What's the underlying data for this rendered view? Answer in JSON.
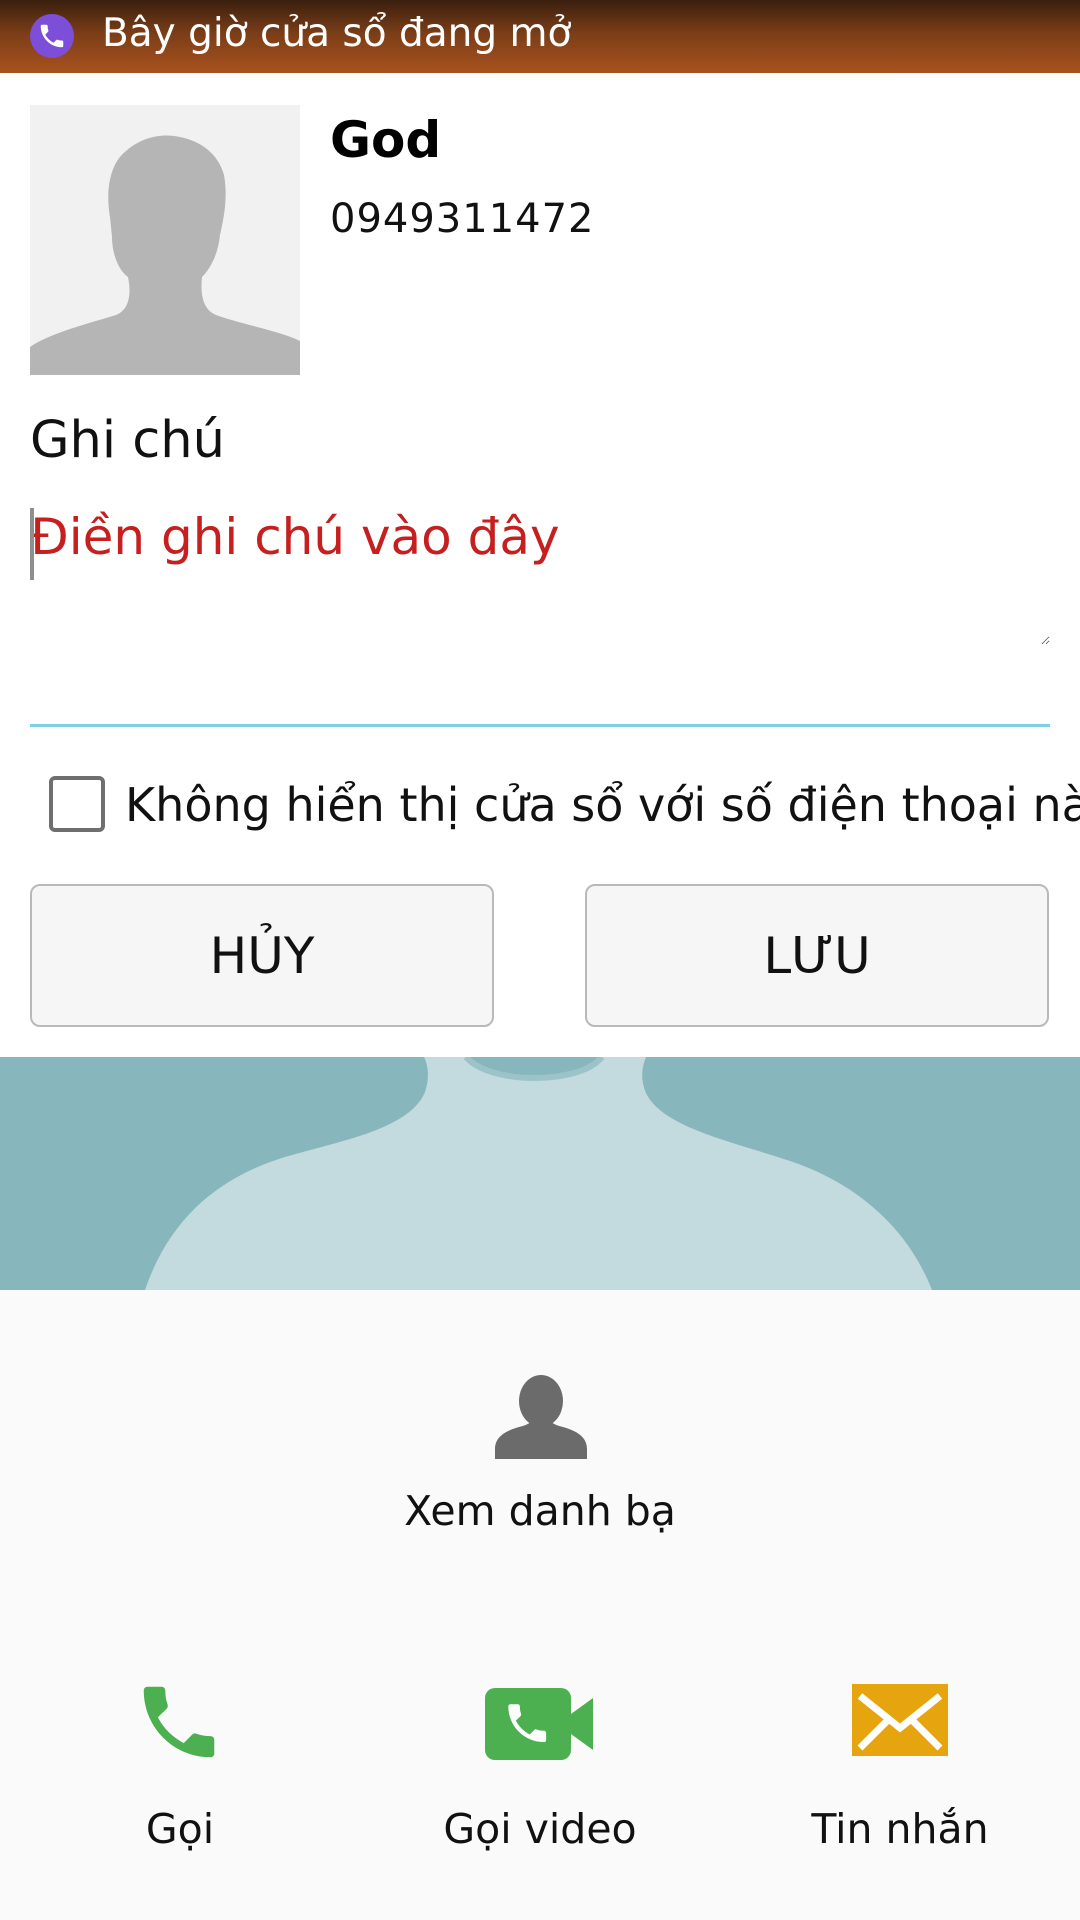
{
  "status_bar": {
    "notification": "Bây giờ cửa sổ đang mở",
    "app_icon": "viber-phone-icon"
  },
  "contact": {
    "name": "God",
    "phone": "0949311472",
    "avatar_icon": "person-silhouette-icon"
  },
  "note": {
    "label": "Ghi chú",
    "placeholder": "Điền ghi chú vào đây",
    "value": ""
  },
  "option": {
    "label": "Không hiển thị cửa sổ với số điện thoại này",
    "checked": false
  },
  "buttons": {
    "cancel": "HỦY",
    "save": "LƯU"
  },
  "view_contacts": {
    "label": "Xem danh bạ",
    "icon": "person-icon"
  },
  "actions": [
    {
      "label": "Gọi",
      "icon": "phone-icon",
      "color": "#4caf50"
    },
    {
      "label": "Gọi video",
      "icon": "video-call-icon",
      "color": "#4caf50"
    },
    {
      "label": "Tin nhắn",
      "icon": "envelope-icon",
      "color": "#e6a50f"
    }
  ],
  "colors": {
    "placeholder": "#c61f1f",
    "note_underline": "#7fd0e2",
    "banner_bg": "#87b7bd",
    "banner_silhouette": "#c3dbdf"
  }
}
